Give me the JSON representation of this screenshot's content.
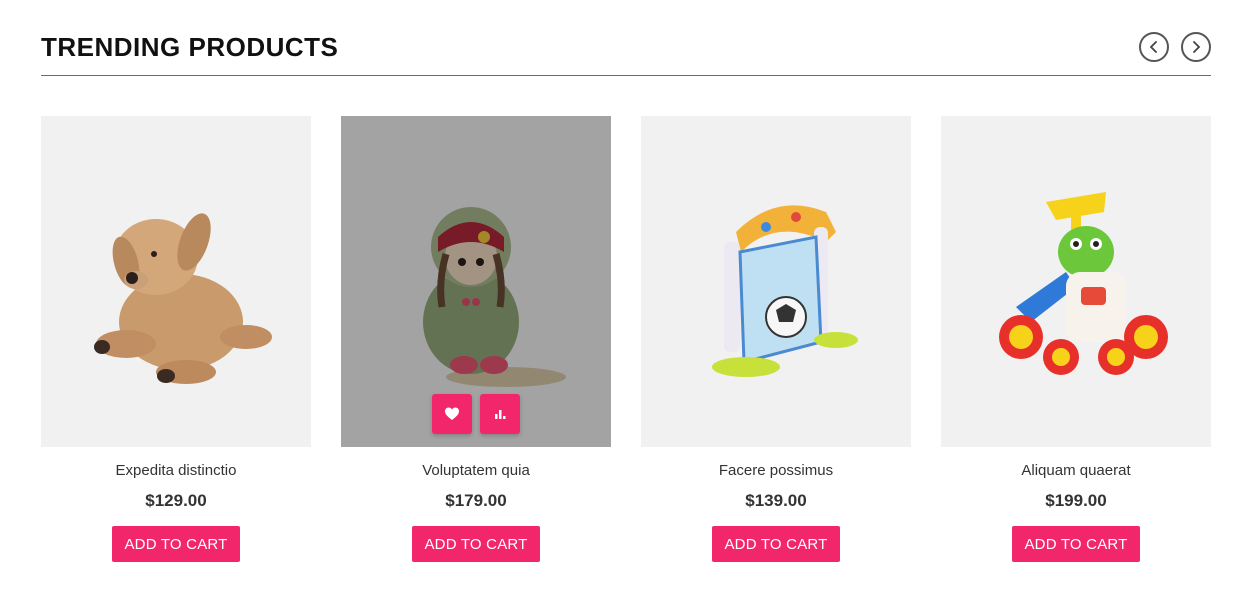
{
  "section": {
    "title": "TRENDING PRODUCTS",
    "nav_prev_icon": "chevron-left-icon",
    "nav_next_icon": "chevron-right-icon"
  },
  "products": [
    {
      "name": "Expedita distinctio",
      "price": "$129.00",
      "cta": "ADD TO CART",
      "image": "plush-dog",
      "hovered": false
    },
    {
      "name": "Voluptatem quia",
      "price": "$179.00",
      "cta": "ADD TO CART",
      "image": "rag-doll",
      "hovered": true,
      "actions": [
        "heart-icon",
        "compare-chart-icon"
      ]
    },
    {
      "name": "Facere possimus",
      "price": "$139.00",
      "cta": "ADD TO CART",
      "image": "toy-soccer-goal",
      "hovered": false
    },
    {
      "name": "Aliquam quaerat",
      "price": "$199.00",
      "cta": "ADD TO CART",
      "image": "baby-walker",
      "hovered": false
    }
  ],
  "colors": {
    "accent": "#f2266a",
    "divider": "#b33aa8"
  }
}
